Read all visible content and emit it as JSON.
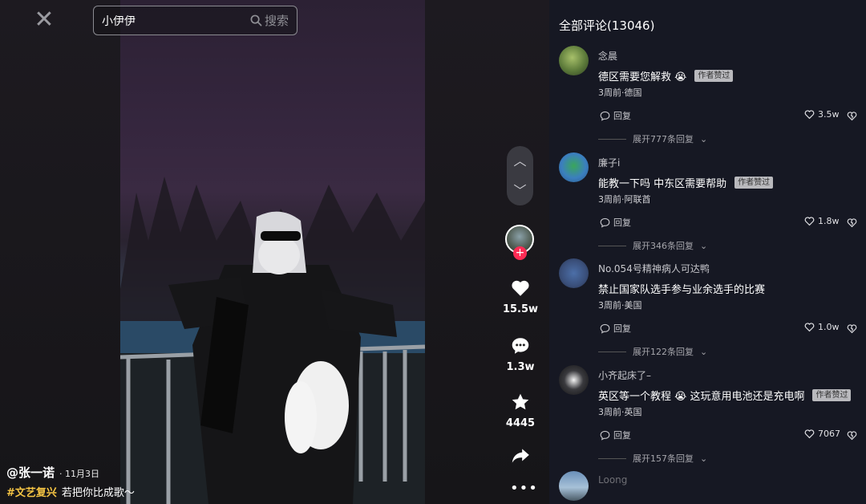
{
  "search": {
    "value": "小伊伊",
    "button_label": "搜索"
  },
  "video": {
    "author": "@张一诺",
    "date": "· 11月3日",
    "hashtag": "#文艺复兴",
    "caption": "若把你比成歌～"
  },
  "actions": {
    "likes": "15.5w",
    "comments": "1.3w",
    "favorites": "4445"
  },
  "comments_panel": {
    "title": "全部评论(13046)",
    "reply_label": "回复",
    "author_liked_tag": "作者赞过",
    "items": [
      {
        "name": "念晨",
        "text": "德区需要您解救 😭",
        "author_liked": true,
        "meta": "3周前·德国",
        "likes": "3.5w",
        "expand": "展开777条回复"
      },
      {
        "name": "廉子i",
        "text": "能教一下吗 中东区需要帮助",
        "author_liked": true,
        "meta": "3周前·阿联酋",
        "likes": "1.8w",
        "expand": "展开346条回复"
      },
      {
        "name": "No.054号精神病人可达鸭",
        "text": "禁止国家队选手参与业余选手的比赛",
        "author_liked": false,
        "meta": "3周前·美国",
        "likes": "1.0w",
        "expand": "展开122条回复"
      },
      {
        "name": "小齐起床了–",
        "text": "英区等一个教程 😭 这玩意用电池还是充电啊",
        "author_liked": true,
        "meta": "3周前·英国",
        "likes": "7067",
        "expand": "展开157条回复"
      },
      {
        "name": "Loong",
        "text": "",
        "author_liked": false,
        "meta": "",
        "likes": "",
        "expand": ""
      }
    ]
  },
  "colors": {
    "accent_red": "#fe2c55",
    "hashtag_yellow": "#f6c544",
    "panel_bg": "#161823"
  }
}
